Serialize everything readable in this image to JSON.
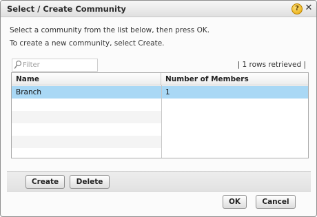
{
  "dialog": {
    "title": "Select / Create Community",
    "help_icon": "?",
    "close_icon": "✕"
  },
  "instructions": {
    "line1": "Select a community from the list below, then press OK.",
    "line2": "To create a new community, select Create."
  },
  "filter": {
    "placeholder": "Filter",
    "value": ""
  },
  "rows_retrieved": "| 1 rows retrieved |",
  "grid": {
    "columns": [
      "Name",
      "Number of Members"
    ],
    "rows": [
      {
        "name": "Branch",
        "members": "1",
        "selected": true
      }
    ]
  },
  "buttons": {
    "create": "Create",
    "delete": "Delete",
    "ok": "OK",
    "cancel": "Cancel"
  },
  "colors": {
    "selected_row": "#a9d8f5"
  }
}
